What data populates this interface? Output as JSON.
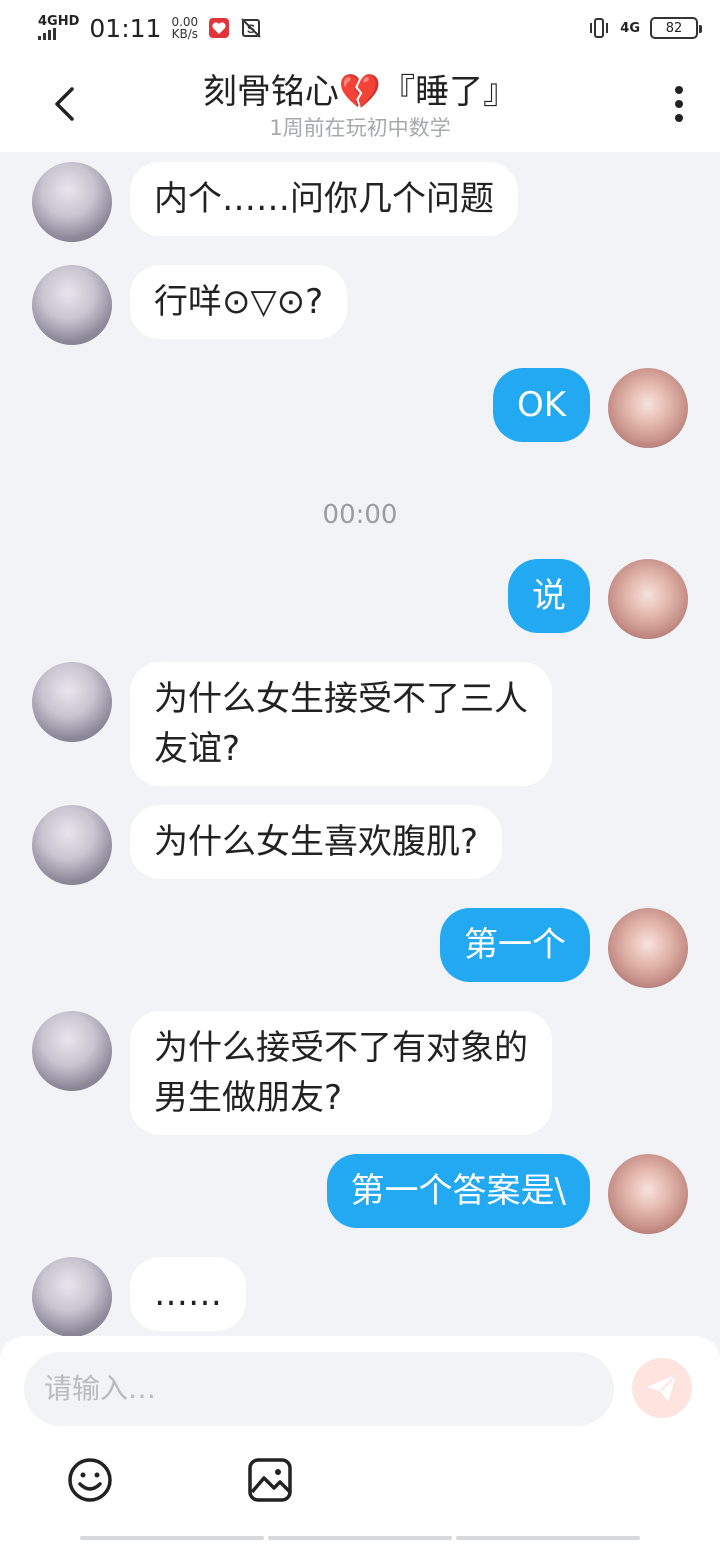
{
  "status_bar": {
    "net_type": "4GHD",
    "time": "01:11",
    "speed_value": "0.00",
    "speed_unit": "KB/s",
    "right_net": "4G",
    "battery": "82"
  },
  "header": {
    "title": "刻骨铭心💔『睡了』",
    "subtitle": "1周前在玩初中数学"
  },
  "messages": [
    {
      "side": "peer",
      "text": "内个……问你几个问题"
    },
    {
      "side": "peer",
      "text": "行咩⊙▽⊙?"
    },
    {
      "side": "me",
      "text": "OK"
    },
    {
      "side": "time",
      "text": "00:00"
    },
    {
      "side": "me",
      "text": "说"
    },
    {
      "side": "peer",
      "line1": "为什么女生接受不了三人",
      "line2": "友谊?"
    },
    {
      "side": "peer",
      "text": "为什么女生喜欢腹肌?"
    },
    {
      "side": "me",
      "text": "第一个"
    },
    {
      "side": "peer",
      "line1": "为什么接受不了有对象的",
      "line2": "男生做朋友?"
    },
    {
      "side": "me",
      "text": "第一个答案是\\"
    },
    {
      "side": "peer",
      "text": "……"
    }
  ],
  "input": {
    "placeholder": "请输入…"
  },
  "colors": {
    "my_bubble": "#23a9f2",
    "peer_bubble": "#ffffff",
    "background": "#f2f3f7",
    "send_button": "#fde4df"
  },
  "icons": [
    "back-icon",
    "more-icon",
    "emoji-icon",
    "image-icon",
    "send-icon"
  ]
}
